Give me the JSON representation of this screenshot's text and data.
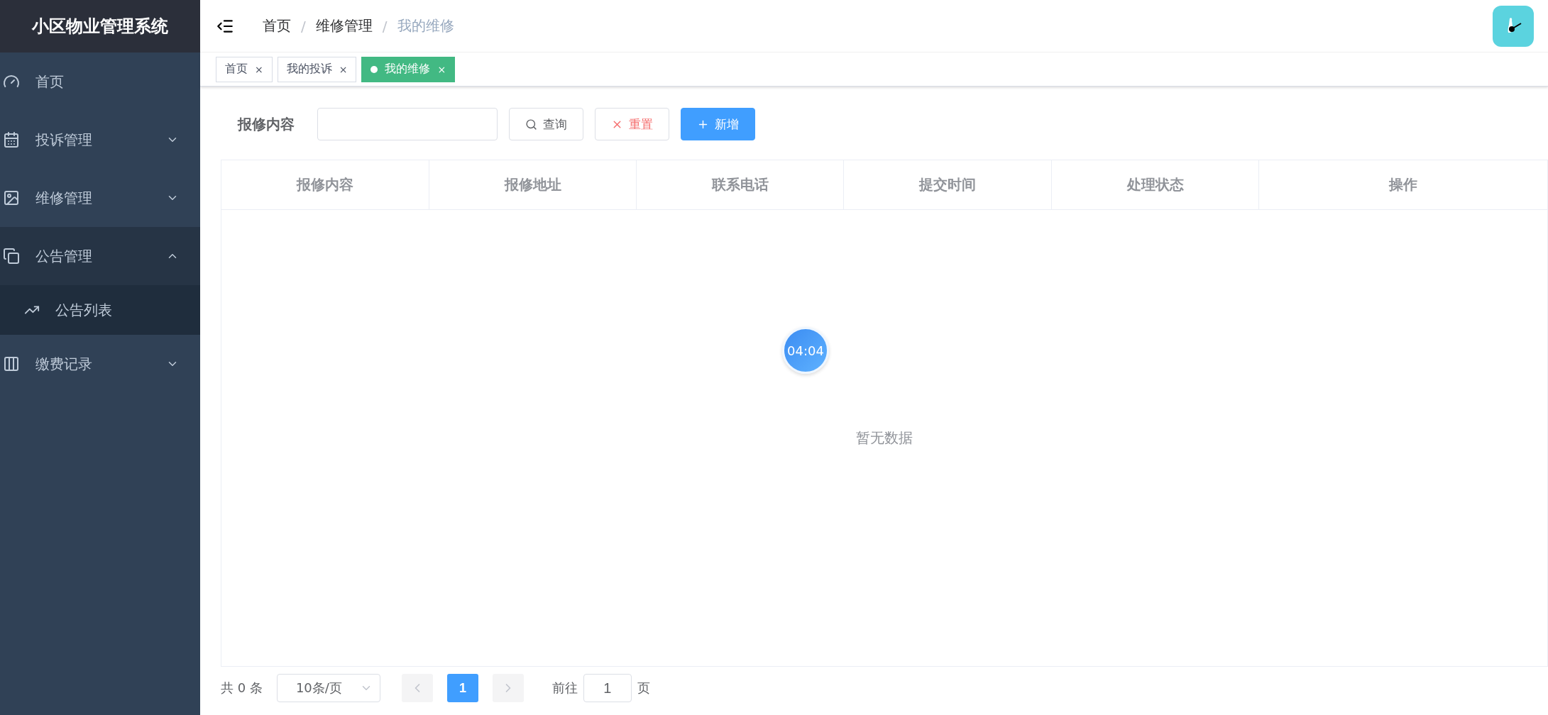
{
  "sidebar": {
    "title": "小区物业管理系统",
    "items": [
      {
        "label": "首页",
        "kind": "item"
      },
      {
        "label": "投诉管理",
        "kind": "submenu",
        "expanded": false
      },
      {
        "label": "维修管理",
        "kind": "submenu",
        "expanded": false
      },
      {
        "label": "公告管理",
        "kind": "submenu",
        "expanded": true,
        "children": [
          {
            "label": "公告列表"
          }
        ]
      },
      {
        "label": "缴费记录",
        "kind": "submenu",
        "expanded": false
      }
    ]
  },
  "breadcrumb": [
    {
      "label": "首页",
      "current": false
    },
    {
      "label": "维修管理",
      "current": false
    },
    {
      "label": "我的维修",
      "current": true
    }
  ],
  "breadcrumb_separator": "/",
  "tags": [
    {
      "label": "首页",
      "selected": false,
      "close": "×"
    },
    {
      "label": "我的投诉",
      "selected": false,
      "close": "×"
    },
    {
      "label": "我的维修",
      "selected": true,
      "close": "×"
    }
  ],
  "filter": {
    "label": "报修内容",
    "buttons": [
      {
        "label": "查询",
        "kind": "search"
      },
      {
        "label": "重置",
        "kind": "reset"
      },
      {
        "label": "新增",
        "kind": "add"
      }
    ]
  },
  "table": {
    "columns": [
      "报修内容",
      "报修地址",
      "联系电话",
      "提交时间",
      "处理状态",
      "操作"
    ],
    "empty_text": "暂无数据"
  },
  "timer": "04:04",
  "pagination": {
    "total": "共 0 条",
    "page_size": "10条/页",
    "pages": [
      {
        "label": "1",
        "selected": true
      }
    ],
    "goto_label": "前往",
    "goto_value": "1",
    "goto_suffix": "页"
  }
}
